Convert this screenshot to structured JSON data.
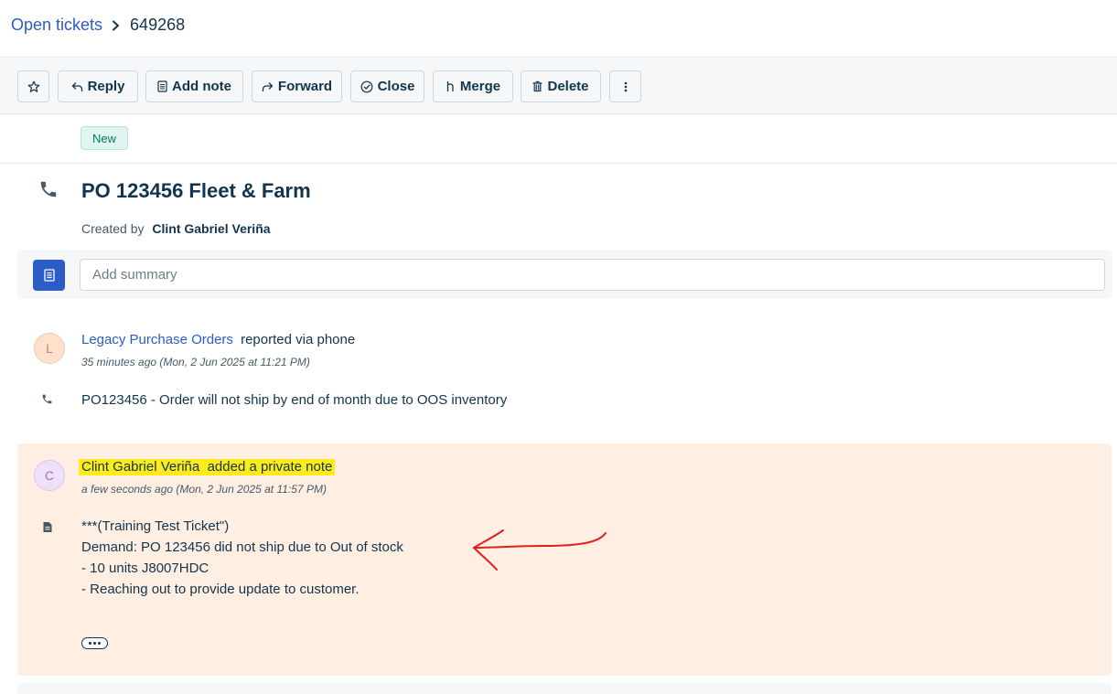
{
  "breadcrumb": {
    "parent": "Open tickets",
    "current": "649268"
  },
  "toolbar": {
    "reply": "Reply",
    "add_note": "Add note",
    "forward": "Forward",
    "close": "Close",
    "merge": "Merge",
    "delete": "Delete"
  },
  "ticket": {
    "status": "New",
    "title": "PO 123456 Fleet & Farm",
    "created_prefix": "Created by",
    "created_by": "Clint Gabriel Veriña",
    "summary_placeholder": "Add summary"
  },
  "conversation": [
    {
      "avatar": "L",
      "author": "Legacy Purchase Orders",
      "action": "reported via phone",
      "time": "35 minutes ago (Mon, 2 Jun 2025 at 11:21 PM)",
      "body": "PO123456 - Order will not ship by end of month due to OOS inventory",
      "icon": "phone-icon"
    },
    {
      "avatar": "C",
      "author": "Clint Gabriel Veriña",
      "action": "added a private note",
      "time": "a few seconds ago (Mon, 2 Jun 2025 at 11:57 PM)",
      "body_lines": [
        "***(Training Test Ticket\")",
        "Demand: PO 123456 did not ship due to Out of stock",
        "- 10 units J8007HDC",
        "- Reaching out to provide update to customer."
      ],
      "icon": "document-icon",
      "background": "#feefe2",
      "highlight": "#ffeb1a"
    }
  ],
  "colors": {
    "link": "#2c5cc5",
    "text": "#12344d",
    "annotation": "#e02020"
  }
}
